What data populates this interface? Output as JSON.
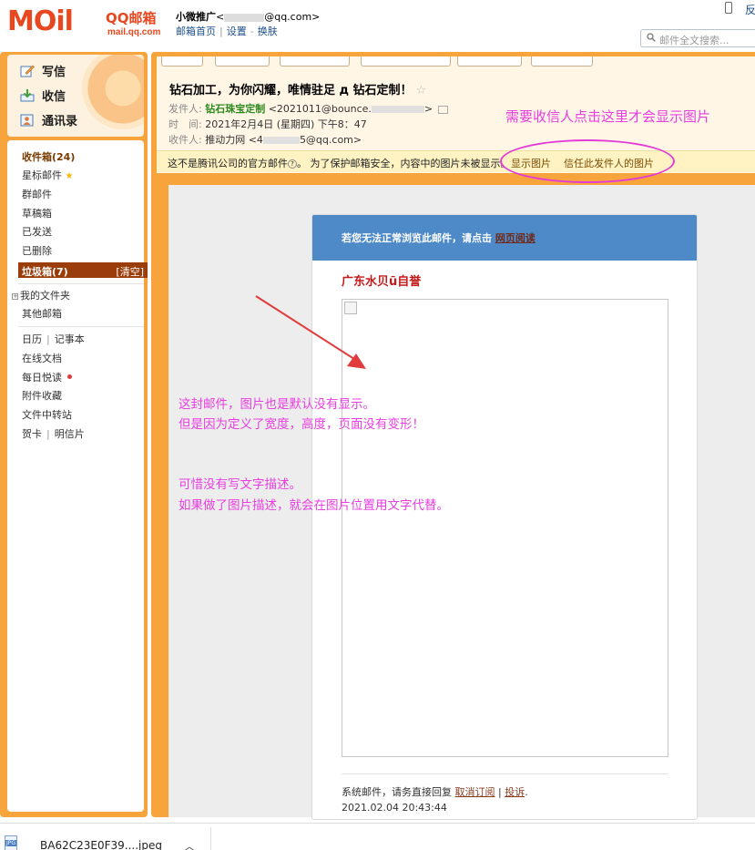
{
  "header": {
    "logo_text": "MOil",
    "logo_brand": "QQ邮箱",
    "logo_url": "mail.qq.com",
    "user_name": "小微推广",
    "user_email_prefix": "<",
    "user_email_suffix": "@qq.com>",
    "links": [
      "邮箱首页",
      "设置",
      "换肤"
    ],
    "top_right_text": "反",
    "search_placeholder": "邮件全文搜索..."
  },
  "sidebar": {
    "compose": "写信",
    "inbox_btn": "收信",
    "contacts": "通讯录",
    "folders": [
      {
        "label": "收件箱(24)",
        "bold": true
      },
      {
        "label": "星标邮件",
        "icon": "star-icon"
      },
      {
        "label": "群邮件"
      },
      {
        "label": "草稿箱"
      },
      {
        "label": "已发送"
      },
      {
        "label": "已删除"
      }
    ],
    "junk_label": "垃圾箱(7)",
    "junk_clear": "[清空]",
    "my_folders": "我的文件夹",
    "other_mail": "其他邮箱",
    "calendar": "日历",
    "notes": "记事本",
    "online_docs": "在线文档",
    "daily_read": "每日悦读",
    "attachments": "附件收藏",
    "file_transfer": "文件中转站",
    "greeting_card": "贺卡",
    "postcard": "明信片"
  },
  "mail": {
    "subject": "钻石加工，为你闪耀，唯情驻足 д 钻石定制！",
    "from_label": "发件人:",
    "from_name": "钻石珠宝定制",
    "from_addr_start": "<2021011@bounce.",
    "from_addr_end": ">",
    "time_label": "时　间:",
    "time_value": "2021年2月4日 (星期四) 下午8：47",
    "to_label": "收件人:",
    "to_name": "推动力网",
    "to_addr_start": "<4",
    "to_addr_end": "5@qq.com>",
    "warning": "这不是腾讯公司的官方邮件",
    "warning_tail": "。 为了保护邮箱安全，内容中的图片未被显示。",
    "show_images": "显示图片",
    "trust_sender": "信任此发件人的图片",
    "browser_hint": "若您无法正常浏览此邮件，请点击",
    "web_read": "网页阅读",
    "body_heading": "广东水贝ū自誉",
    "footer_text": "系统邮件，请务直接回复",
    "unsubscribe": "取消订阅",
    "report": "投诉",
    "footer_end": ".",
    "footer_date": "2021.02.04 20:43:44"
  },
  "annotations": {
    "top": "需要收信人点击这里才会显示图片",
    "line1": "这封邮件，图片也是默认没有显示。",
    "line2": "但是因为定义了宽度，高度，页面没有变形！",
    "line3": "可惜没有写文字描述。",
    "line4": "如果做了图片描述，就会在图片位置用文字代替。"
  },
  "download_bar": {
    "filename": "BA62C23E0F39....jpeg",
    "file_type": "JPG"
  },
  "colors": {
    "frame_orange": "#f7a43c",
    "annotation_magenta": "#e83ee0",
    "junk_brown": "#9b3d0a",
    "email_blue": "#4e8ac8",
    "heading_red": "#c21a1a"
  }
}
